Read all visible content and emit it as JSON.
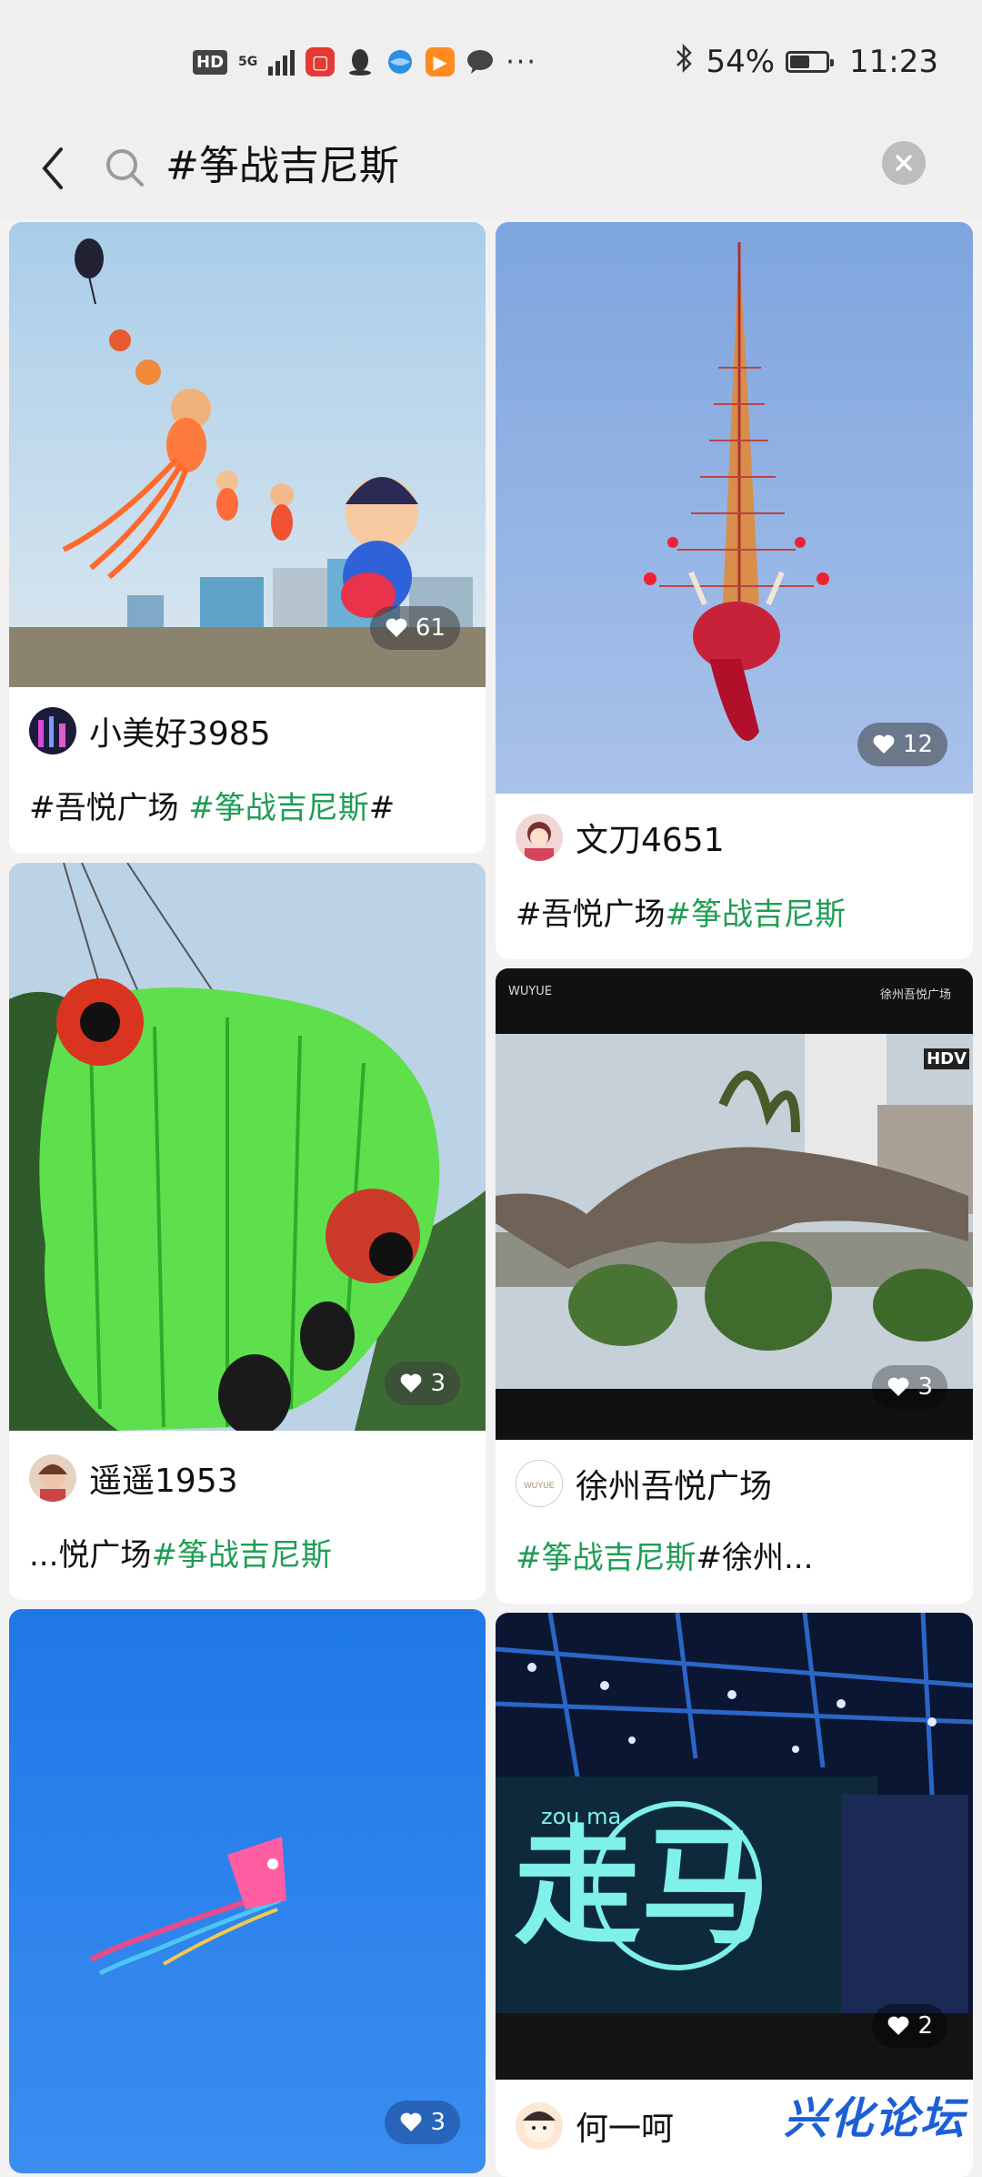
{
  "status_bar": {
    "hd": "HD",
    "network": "5G",
    "battery_percent": "54%",
    "battery_level": 0.54,
    "time": "11:23",
    "more": "···",
    "notification_icons": [
      "notes-app-icon",
      "qq-penguin-icon",
      "browser-globe-icon",
      "video-play-icon",
      "chat-bubble-icon"
    ]
  },
  "search": {
    "query": "#筝战吉尼斯"
  },
  "posts": [
    {
      "likes": "61",
      "author": "小美好3985",
      "tags": [
        {
          "text": "#吾悦广场 ",
          "highlight": false
        },
        {
          "text": "#筝战吉尼斯",
          "highlight": true
        },
        {
          "text": "#",
          "highlight": false
        }
      ],
      "image": "sky-with-doll-kites"
    },
    {
      "likes": "12",
      "author": "文刀4651",
      "tags": [
        {
          "text": "#吾悦广场",
          "highlight": false
        },
        {
          "text": "#筝战吉尼斯",
          "highlight": true
        }
      ],
      "image": "long-dragon-kite"
    },
    {
      "likes": "3",
      "author": "遥遥1953",
      "tags": [
        {
          "text": "...悦广场",
          "highlight": false
        },
        {
          "text": "#筝战吉尼斯",
          "highlight": true
        }
      ],
      "image": "green-caterpillar-kite"
    },
    {
      "likes": "3",
      "author": "徐州吾悦广场",
      "tags": [
        {
          "text": "#筝战吉尼斯",
          "highlight": true
        },
        {
          "text": "#徐州...",
          "highlight": false
        }
      ],
      "image": "dinosaur-video",
      "video_overlay": {
        "brand_left": "WUYUE",
        "brand_right": "徐州吾悦广场",
        "hd_badge": "HDV"
      }
    },
    {
      "likes": "3",
      "author": "",
      "tags": [],
      "image": "squid-kite-blue-sky"
    },
    {
      "likes": "2",
      "author": "何一呵",
      "tags": [],
      "image": "concert-stage",
      "stage_text": "zou ma"
    }
  ],
  "watermark": "兴化论坛",
  "colors": {
    "tag_green": "#1f9d55",
    "background": "#f2f2f2",
    "watermark_blue": "#1e5fd6"
  }
}
